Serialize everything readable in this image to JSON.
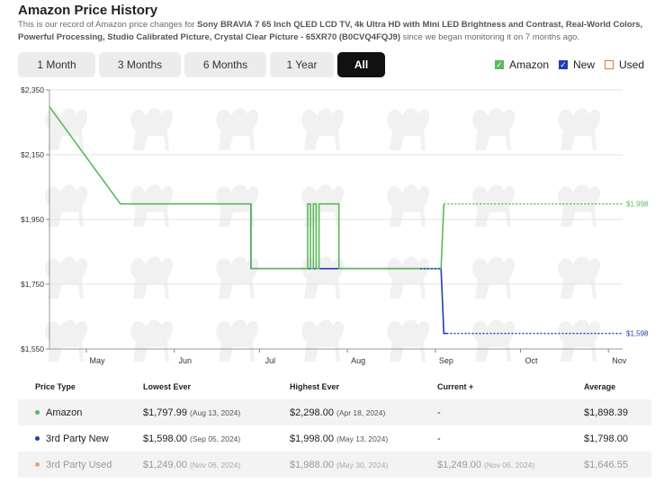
{
  "header": {
    "title": "Amazon Price History",
    "desc_prefix": "This is our record of Amazon price changes for ",
    "product": "Sony BRAVIA 7 65 Inch QLED LCD TV, 4k Ultra HD with Mini LED Brightness and Contrast, Real-World Colors, Powerful Processing, Studio Calibrated Picture, Crystal Clear Picture - 65XR70 (B0CVQ4FQJ9)",
    "desc_suffix": " since we began monitoring it on 7 months ago."
  },
  "ranges": [
    "1 Month",
    "3 Months",
    "6 Months",
    "1 Year",
    "All"
  ],
  "active_range": "All",
  "legend": {
    "amazon": {
      "label": "Amazon",
      "checked": true,
      "color": "#5cb85c"
    },
    "new": {
      "label": "New",
      "checked": true,
      "color": "#1f3fb5"
    },
    "used": {
      "label": "Used",
      "checked": false,
      "color": "#e07b3c"
    }
  },
  "chart_data": {
    "type": "line",
    "xlabel": "",
    "ylabel": "",
    "y_ticks": [
      "$2,350",
      "$2,150",
      "$1,950",
      "$1,750",
      "$1,550"
    ],
    "x_ticks": [
      "May",
      "Jun",
      "Jul",
      "Aug",
      "Sep",
      "Oct",
      "Nov"
    ],
    "ylim": [
      1550,
      2350
    ],
    "xlim": [
      "2024-04-18",
      "2024-11-06"
    ],
    "x_tick_dates": [
      "2024-05-01",
      "2024-06-01",
      "2024-07-01",
      "2024-08-01",
      "2024-09-01",
      "2024-10-01",
      "2024-11-01"
    ],
    "grid": true,
    "series": [
      {
        "name": "Amazon",
        "color": "#5cb85c",
        "points": [
          [
            "2024-04-18",
            2298
          ],
          [
            "2024-05-13",
            1998
          ],
          [
            "2024-06-28",
            1998
          ],
          [
            "2024-06-28",
            1798
          ],
          [
            "2024-07-18",
            1798
          ],
          [
            "2024-07-18",
            1998
          ],
          [
            "2024-07-19",
            1998
          ],
          [
            "2024-07-19",
            1798
          ],
          [
            "2024-07-20",
            1798
          ],
          [
            "2024-07-20",
            1998
          ],
          [
            "2024-07-21",
            1998
          ],
          [
            "2024-07-21",
            1798
          ],
          [
            "2024-07-22",
            1798
          ],
          [
            "2024-07-22",
            1998
          ],
          [
            "2024-07-29",
            1998
          ],
          [
            "2024-07-29",
            1798
          ],
          [
            "2024-08-26",
            1798
          ]
        ],
        "dotted_to": [
          "2024-09-03",
          1798
        ],
        "jump": [
          "2024-09-04",
          1998
        ],
        "dotted_end": [
          "2024-11-06",
          1998
        ],
        "end_label": "$1,998"
      },
      {
        "name": "New",
        "color": "#1f3fb5",
        "points": [
          [
            "2024-06-28",
            1998
          ],
          [
            "2024-06-28",
            1798
          ],
          [
            "2024-07-18",
            1798
          ],
          [
            "2024-07-22",
            1798
          ],
          [
            "2024-07-29",
            1798
          ],
          [
            "2024-08-26",
            1798
          ],
          [
            "2024-09-03",
            1798
          ],
          [
            "2024-09-04",
            1598
          ],
          [
            "2024-09-05",
            1598
          ]
        ],
        "dotted_end": [
          "2024-11-06",
          1598
        ],
        "end_label": "$1,598"
      }
    ]
  },
  "table": {
    "headers": [
      "Price Type",
      "Lowest Ever",
      "Highest Ever",
      "Current +",
      "Average"
    ],
    "rows": [
      {
        "type": "Amazon",
        "dot": "#5cb85c",
        "lowest": "$1,797.99",
        "lowest_date": "(Aug 13, 2024)",
        "highest": "$2,298.00",
        "highest_date": "(Apr 18, 2024)",
        "current": "-",
        "current_date": "",
        "average": "$1,898.39"
      },
      {
        "type": "3rd Party New",
        "dot": "#1f3fb5",
        "lowest": "$1,598.00",
        "lowest_date": "(Sep 05, 2024)",
        "highest": "$1,998.00",
        "highest_date": "(May 13, 2024)",
        "current": "-",
        "current_date": "",
        "average": "$1,798.00"
      },
      {
        "type": "3rd Party Used",
        "dot": "#e8a37b",
        "lowest": "$1,249.00",
        "lowest_date": "(Nov 06, 2024)",
        "highest": "$1,988.00",
        "highest_date": "(May 30, 2024)",
        "current": "$1,249.00",
        "current_date": "(Nov 06, 2024)",
        "average": "$1,646.55"
      }
    ]
  }
}
